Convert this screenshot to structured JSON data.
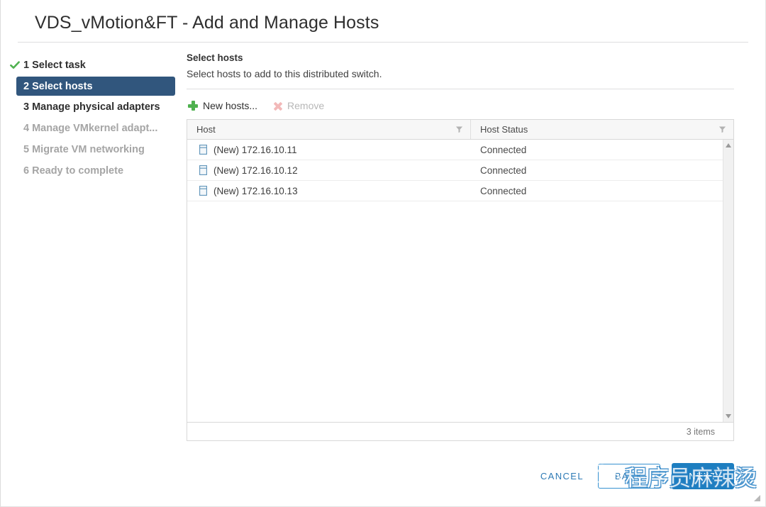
{
  "window": {
    "title": "VDS_vMotion&FT - Add and Manage Hosts"
  },
  "steps": [
    {
      "label": "1 Select task",
      "state": "complete"
    },
    {
      "label": "2 Select hosts",
      "state": "active"
    },
    {
      "label": "3 Manage physical adapters",
      "state": "enabled"
    },
    {
      "label": "4 Manage VMkernel adapt...",
      "state": "disabled"
    },
    {
      "label": "5 Migrate VM networking",
      "state": "disabled"
    },
    {
      "label": "6 Ready to complete",
      "state": "disabled"
    }
  ],
  "section": {
    "heading": "Select hosts",
    "description": "Select hosts to add to this distributed switch."
  },
  "toolbar": {
    "new_hosts_label": "New hosts...",
    "remove_label": "Remove"
  },
  "table": {
    "columns": [
      "Host",
      "Host Status"
    ],
    "rows": [
      {
        "host": "(New) 172.16.10.11",
        "status": "Connected"
      },
      {
        "host": "(New) 172.16.10.12",
        "status": "Connected"
      },
      {
        "host": "(New) 172.16.10.13",
        "status": "Connected"
      }
    ],
    "item_count": "3 items"
  },
  "footer": {
    "cancel_label": "CANCEL",
    "back_label": "BACK",
    "next_label": "NEXT"
  },
  "watermark": {
    "text": "程序员麻辣烫"
  },
  "colors": {
    "active_step": "#31567d",
    "primary_button": "#1d7ec0",
    "link": "#2d7ab5",
    "add_icon": "#4fb14f",
    "check": "#4fb14f"
  }
}
